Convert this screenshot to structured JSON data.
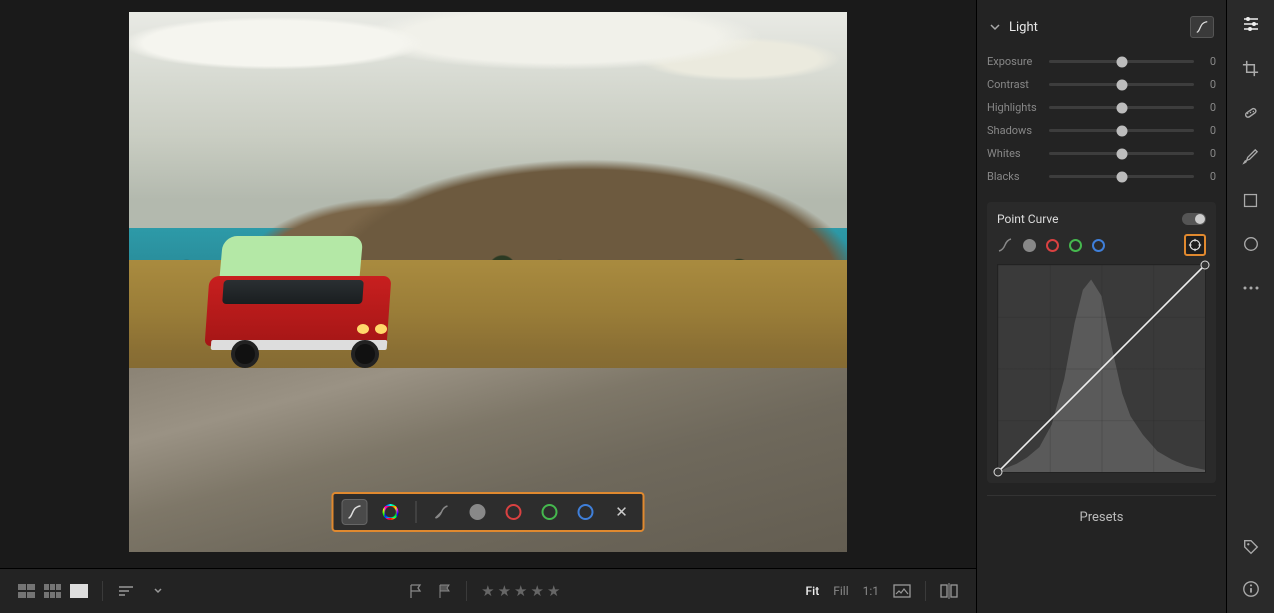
{
  "panel": {
    "section_title": "Light",
    "sliders": [
      {
        "label": "Exposure",
        "value": "0"
      },
      {
        "label": "Contrast",
        "value": "0"
      },
      {
        "label": "Highlights",
        "value": "0"
      },
      {
        "label": "Shadows",
        "value": "0"
      },
      {
        "label": "Whites",
        "value": "0"
      },
      {
        "label": "Blacks",
        "value": "0"
      }
    ],
    "point_curve_title": "Point Curve",
    "presets_label": "Presets"
  },
  "bottombar": {
    "zoom_fit": "Fit",
    "zoom_fill": "Fill",
    "zoom_1to1": "1:1"
  },
  "icons": {
    "curve": "curve-icon",
    "parametric": "parametric-icon",
    "lum": "lum-channel-icon",
    "red": "red-channel-icon",
    "green": "green-channel-icon",
    "blue": "blue-channel-icon",
    "close": "close-icon",
    "hue": "hue-wheel-icon",
    "target": "target-adjust-icon",
    "sliders": "edit-sliders-icon",
    "crop": "crop-icon",
    "heal": "healing-icon",
    "brush": "brush-icon",
    "linear": "linear-gradient-icon",
    "radial": "radial-gradient-icon",
    "more": "more-icon",
    "tag": "tag-icon",
    "info": "info-icon",
    "chevron": "chevron-down-icon",
    "pick": "flag-pick-icon",
    "reject": "flag-reject-icon",
    "star": "star-icon",
    "grid1": "grid-large-icon",
    "grid2": "grid-small-icon",
    "single": "single-view-icon",
    "sort": "sort-icon",
    "orig": "show-original-icon",
    "compare": "compare-icon"
  }
}
